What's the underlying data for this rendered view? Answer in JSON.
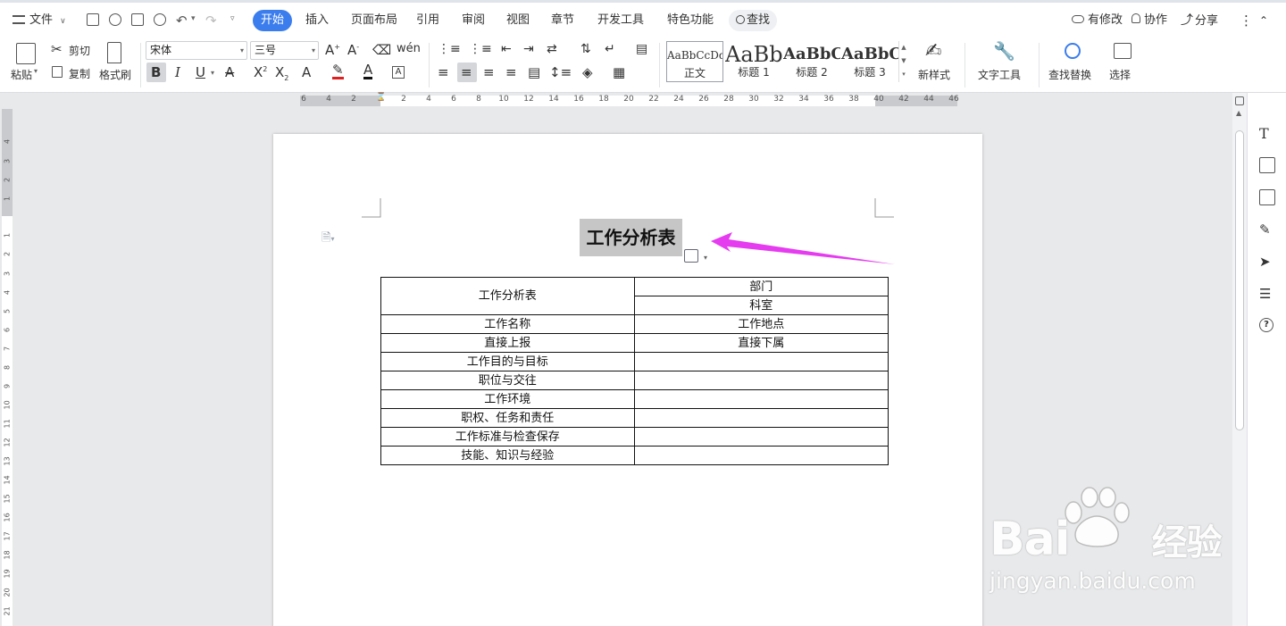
{
  "menu": {
    "file_label": "文件",
    "tabs": [
      {
        "label": "开始",
        "active": true
      },
      {
        "label": "插入"
      },
      {
        "label": "页面布局"
      },
      {
        "label": "引用"
      },
      {
        "label": "审阅"
      },
      {
        "label": "视图"
      },
      {
        "label": "章节"
      },
      {
        "label": "开发工具"
      },
      {
        "label": "特色功能"
      }
    ],
    "search_label": "查找",
    "right": {
      "modify": "有修改",
      "collab": "协作",
      "share": "分享"
    }
  },
  "ribbon": {
    "paste": "粘贴",
    "cut": "剪切",
    "copy": "复制",
    "format_painter": "格式刷",
    "font_name": "宋体",
    "font_size": "三号",
    "styles": [
      {
        "sample": "AaBbCcDd",
        "label": "正文"
      },
      {
        "sample": "AaBb",
        "label": "标题 1"
      },
      {
        "sample": "AaBbC",
        "label": "标题 2"
      },
      {
        "sample": "AaBbC",
        "label": "标题 3"
      }
    ],
    "new_style": "新样式",
    "text_tools": "文字工具",
    "find_replace": "查找替换",
    "select": "选择"
  },
  "ruler": {
    "h_ticks": [
      "6",
      "4",
      "2",
      "2",
      "4",
      "6",
      "8",
      "10",
      "12",
      "14",
      "16",
      "18",
      "20",
      "22",
      "24",
      "26",
      "28",
      "30",
      "32",
      "34",
      "36",
      "38",
      "40",
      "42",
      "44",
      "46"
    ],
    "v_ticks": [
      "4",
      "3",
      "2",
      "1",
      "1",
      "2",
      "3",
      "4",
      "5",
      "6",
      "7",
      "8",
      "9",
      "10",
      "11",
      "12",
      "13",
      "14",
      "15",
      "16",
      "17",
      "18",
      "19",
      "20",
      "21"
    ]
  },
  "document": {
    "title": "工作分析表",
    "table": {
      "header_left": "工作分析表",
      "header_right_top": "部门",
      "header_right_bottom": "科室",
      "rows": [
        [
          "工作名称",
          "工作地点"
        ],
        [
          "直接上报",
          "直接下属"
        ],
        [
          "工作目的与目标",
          ""
        ],
        [
          "职位与交往",
          ""
        ],
        [
          "工作环境",
          ""
        ],
        [
          "职权、任务和责任",
          ""
        ],
        [
          "工作标准与检查保存",
          ""
        ],
        [
          "技能、知识与经验",
          ""
        ]
      ]
    }
  },
  "watermark": {
    "brand": "Bai",
    "suffix": "经验",
    "url": "jingyan.baidu.com"
  },
  "colors": {
    "accent": "#3b7ded",
    "arrow": "#e53cf0",
    "selection": "#c6c6c6"
  }
}
